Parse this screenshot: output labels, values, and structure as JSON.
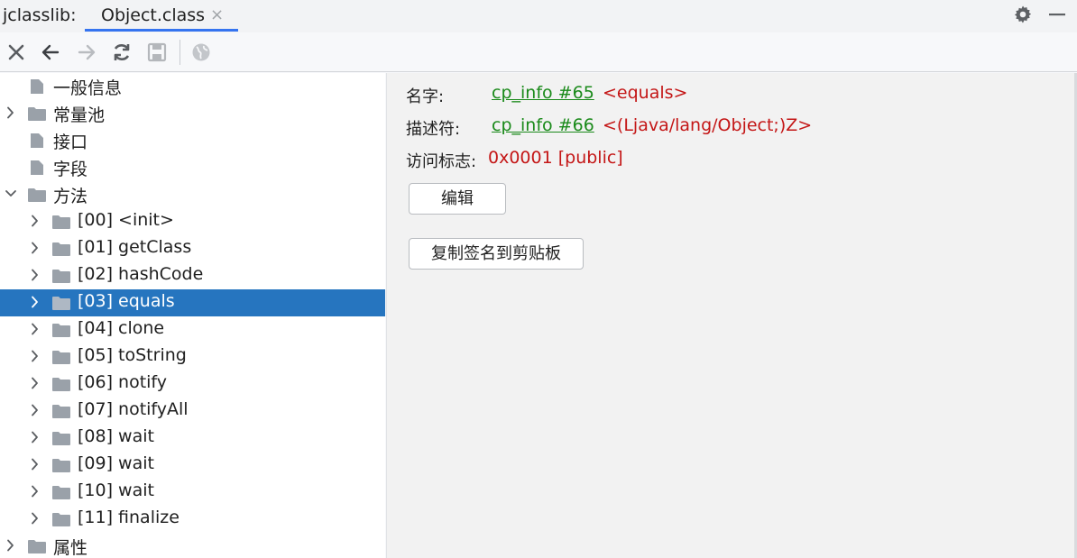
{
  "window": {
    "app_name": "jclasslib:",
    "tab": {
      "label": "Object.class",
      "close": "×"
    }
  },
  "toolbar": {
    "buttons": [
      "close-icon",
      "back-icon",
      "forward-icon",
      "refresh-icon",
      "save-icon",
      "browser-icon"
    ]
  },
  "tree": {
    "items": [
      {
        "label": "一般信息",
        "icon": "file-icon",
        "expandable": false
      },
      {
        "label": "常量池",
        "icon": "folder-icon",
        "expandable": true,
        "expanded": false
      },
      {
        "label": "接口",
        "icon": "file-icon",
        "expandable": false
      },
      {
        "label": "字段",
        "icon": "file-icon",
        "expandable": false
      },
      {
        "label": "方法",
        "icon": "folder-icon",
        "expandable": true,
        "expanded": true
      },
      {
        "label": "[00] <init>",
        "icon": "folder-icon",
        "expandable": true
      },
      {
        "label": "[01] getClass",
        "icon": "folder-icon",
        "expandable": true
      },
      {
        "label": "[02] hashCode",
        "icon": "folder-icon",
        "expandable": true
      },
      {
        "label": "[03] equals",
        "icon": "folder-icon",
        "expandable": true,
        "selected": true
      },
      {
        "label": "[04] clone",
        "icon": "folder-icon",
        "expandable": true
      },
      {
        "label": "[05] toString",
        "icon": "folder-icon",
        "expandable": true
      },
      {
        "label": "[06] notify",
        "icon": "folder-icon",
        "expandable": true
      },
      {
        "label": "[07] notifyAll",
        "icon": "folder-icon",
        "expandable": true
      },
      {
        "label": "[08] wait",
        "icon": "folder-icon",
        "expandable": true
      },
      {
        "label": "[09] wait",
        "icon": "folder-icon",
        "expandable": true
      },
      {
        "label": "[10] wait",
        "icon": "folder-icon",
        "expandable": true
      },
      {
        "label": "[11] finalize",
        "icon": "folder-icon",
        "expandable": true
      },
      {
        "label": "属性",
        "icon": "folder-icon",
        "expandable": true,
        "expanded": false
      }
    ]
  },
  "detail": {
    "name": {
      "key": "名字:",
      "link": "cp_info #65",
      "value": "<equals>"
    },
    "descriptor": {
      "key": "描述符:",
      "link": "cp_info #66",
      "value": "<(Ljava/lang/Object;)Z>"
    },
    "access": {
      "key": "访问标志:",
      "value": "0x0001 [public]"
    },
    "edit_button": "编辑",
    "copy_button": "复制签名到剪贴板"
  },
  "colors": {
    "accent": "#3574f0",
    "selection": "#2675bf",
    "link": "#1a8a1a",
    "value": "#c41616"
  }
}
